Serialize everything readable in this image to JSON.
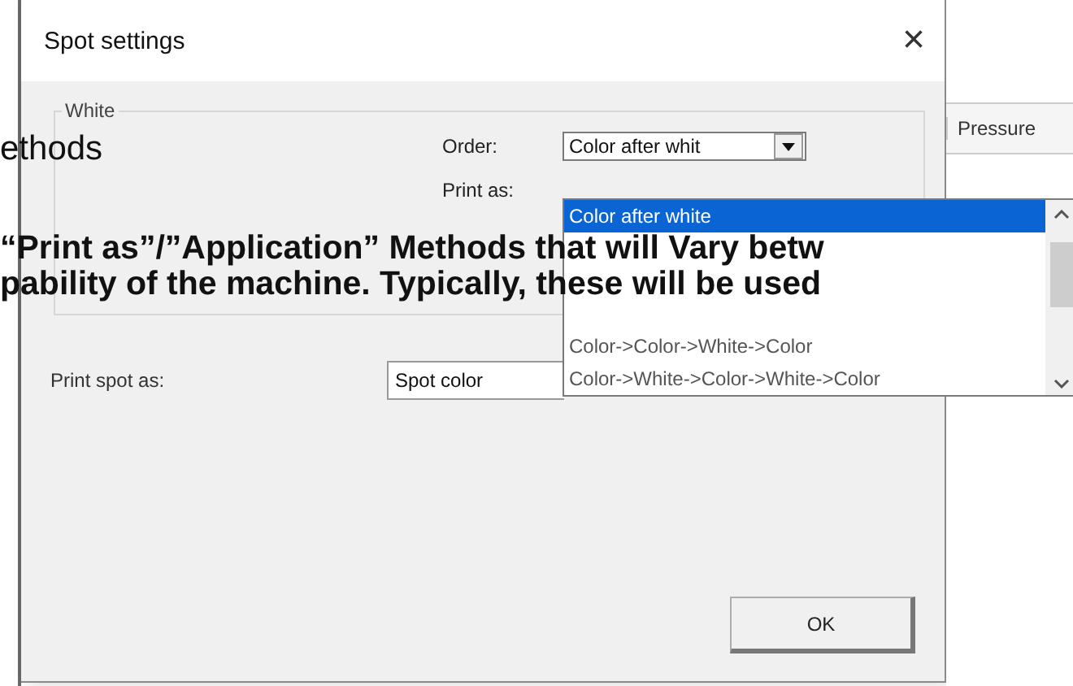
{
  "window": {
    "title": "Spot settings",
    "close": "×"
  },
  "group": {
    "title": "White",
    "order": {
      "label": "Order:",
      "value": "Color after whit"
    },
    "print_as": {
      "label": "Print as:"
    },
    "dropdown_options": [
      {
        "label": "Color after white",
        "selected": true
      },
      {
        "label": "Color->Color->White->Color",
        "selected": false
      },
      {
        "label": "Color->White->Color->White->Color",
        "selected": false
      }
    ]
  },
  "print_spot_as": {
    "label": "Print spot as:",
    "value": "Spot color"
  },
  "buttons": [
    "OK"
  ],
  "background_app": {
    "tab": "Pressure"
  },
  "overlay_text": [
    {
      "text": "ethods",
      "bold": false
    },
    {
      "text": "“Print as”/”Application” Methods that will Vary betw",
      "bold": true
    },
    {
      "text": "pability of the machine. Typically, these will be used",
      "bold": true
    }
  ]
}
